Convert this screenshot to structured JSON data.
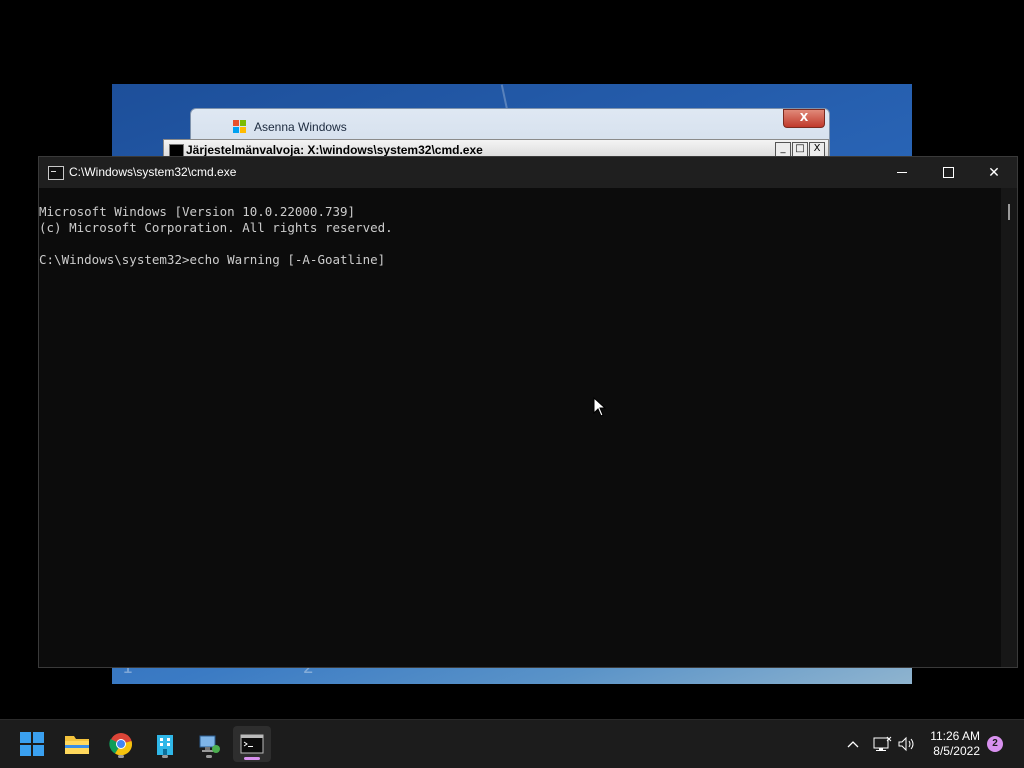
{
  "vm": {
    "setup_window_title": "Asenna Windows",
    "setup_close_label": "X",
    "xp_cmd_title": "Järjestelmänvalvoja: X:\\windows\\system32\\cmd.exe",
    "xp_min": "_",
    "xp_max": "□",
    "xp_close": "X",
    "bottom_numbers": [
      "1",
      "2"
    ]
  },
  "cmd": {
    "title": "C:\\Windows\\system32\\cmd.exe",
    "lines": [
      "Microsoft Windows [Version 10.0.22000.739]",
      "(c) Microsoft Corporation. All rights reserved.",
      "",
      "C:\\Windows\\system32>echo Warning [-A-Goatline]"
    ],
    "close_glyph": "✕"
  },
  "taskbar": {
    "apps": [
      {
        "name": "start-button",
        "icon": "windows-logo-icon"
      },
      {
        "name": "file-explorer",
        "icon": "folder-icon"
      },
      {
        "name": "chrome",
        "icon": "chrome-icon"
      },
      {
        "name": "app-building",
        "icon": "building-icon"
      },
      {
        "name": "network-app",
        "icon": "network-computer-icon"
      },
      {
        "name": "terminal",
        "icon": "terminal-icon"
      }
    ],
    "time": "11:26 AM",
    "date": "8/5/2022",
    "notification_count": "2",
    "accent": "#d891ef"
  }
}
